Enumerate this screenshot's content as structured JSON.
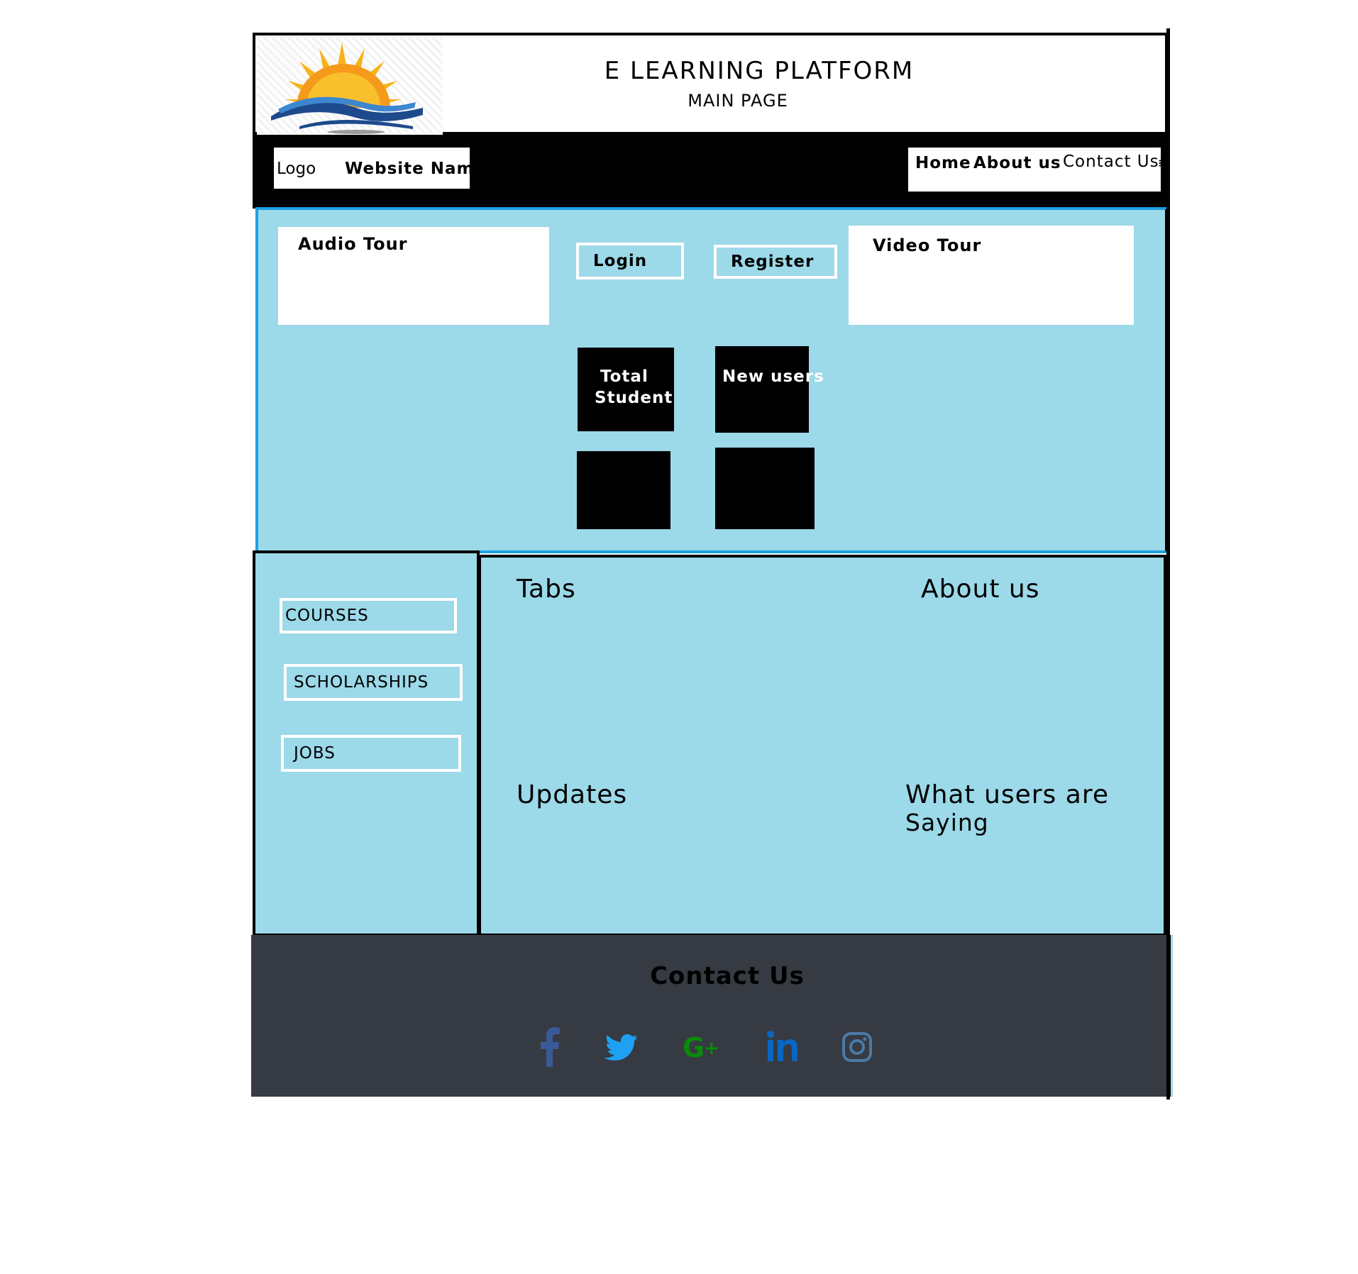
{
  "header": {
    "title": "E  LEARNING PLATFORM",
    "subtitle": "MAIN PAGE",
    "logo_icon": "sunrise-waves-logo"
  },
  "navbar": {
    "brand_logo": "Logo",
    "brand_name": "Website Name",
    "links": [
      "Home",
      "About us",
      "Contact Us"
    ],
    "more": "≡"
  },
  "hero": {
    "audio_tour": "Audio Tour",
    "video_tour": "Video Tour",
    "login": "Login",
    "register": "Register",
    "stats": {
      "total_line1": "Total",
      "total_line2": "Student",
      "new_users": "New users"
    }
  },
  "sidebar": {
    "items": [
      "COURSES",
      "SCHOLARSHIPS",
      "JOBS"
    ]
  },
  "sections": {
    "tabs": "Tabs",
    "about": "About us",
    "updates": "Updates",
    "saying_line1": "What users are",
    "saying_line2": "Saying"
  },
  "footer": {
    "title": "Contact Us",
    "social_icons": [
      "facebook-icon",
      "twitter-icon",
      "google-plus-icon",
      "linkedin-icon",
      "instagram-icon"
    ]
  },
  "colors": {
    "panel": "#9cd9e9",
    "hero_border": "#1ea0e2",
    "footer": "#363a42",
    "facebook": "#3b5998",
    "twitter": "#1da1f2",
    "google_plus": "#0a8a0a",
    "linkedin": "#0a66c2",
    "instagram": "#4a7aa8"
  }
}
